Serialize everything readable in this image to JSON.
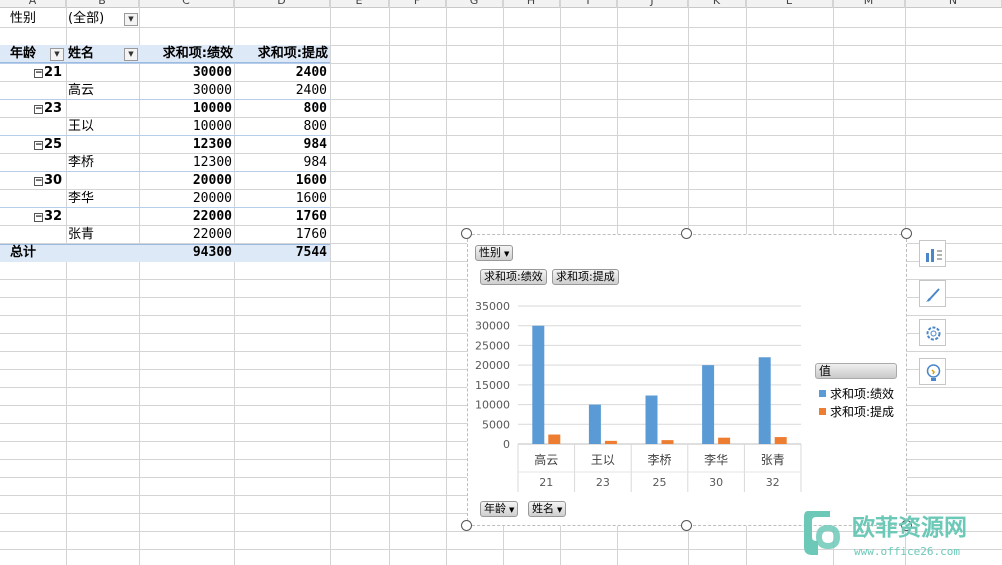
{
  "column_headers": [
    "A",
    "B",
    "C",
    "D",
    "E",
    "F",
    "G",
    "H",
    "I",
    "J",
    "K",
    "L",
    "M",
    "N"
  ],
  "pivot": {
    "filter_label": "性别",
    "filter_value": "(全部)",
    "header": {
      "age": "年龄",
      "name": "姓名",
      "perf": "求和项:绩效",
      "comm": "求和项:提成"
    },
    "groups": [
      {
        "age": "21",
        "perf": "30000",
        "comm": "2400",
        "child": {
          "name": "高云",
          "perf": "30000",
          "comm": "2400"
        }
      },
      {
        "age": "23",
        "perf": "10000",
        "comm": "800",
        "child": {
          "name": "王以",
          "perf": "10000",
          "comm": "800"
        }
      },
      {
        "age": "25",
        "perf": "12300",
        "comm": "984",
        "child": {
          "name": "李桥",
          "perf": "12300",
          "comm": "984"
        }
      },
      {
        "age": "30",
        "perf": "20000",
        "comm": "1600",
        "child": {
          "name": "李华",
          "perf": "20000",
          "comm": "1600"
        }
      },
      {
        "age": "32",
        "perf": "22000",
        "comm": "1760",
        "child": {
          "name": "张青",
          "perf": "22000",
          "comm": "1760"
        }
      }
    ],
    "total": {
      "label": "总计",
      "perf": "94300",
      "comm": "7544"
    }
  },
  "chart_buttons": {
    "filter": "性别",
    "series_perf": "求和项:绩效",
    "series_comm": "求和项:提成",
    "axis_age": "年龄",
    "axis_name": "姓名"
  },
  "chart_data": {
    "type": "bar",
    "categories": [
      "高云",
      "王以",
      "李桥",
      "李华",
      "张青"
    ],
    "outer_categories": [
      "21",
      "23",
      "25",
      "30",
      "32"
    ],
    "series": [
      {
        "name": "求和项:绩效",
        "values": [
          30000,
          10000,
          12300,
          20000,
          22000
        ],
        "color": "#5b9bd5"
      },
      {
        "name": "求和项:提成",
        "values": [
          2400,
          800,
          984,
          1600,
          1760
        ],
        "color": "#ed7d31"
      }
    ],
    "ylim": [
      0,
      35000
    ],
    "yticks": [
      "0",
      "5000",
      "10000",
      "15000",
      "20000",
      "25000",
      "30000",
      "35000"
    ],
    "grid": true,
    "legend_title": "值",
    "legend": "right"
  },
  "watermark": {
    "brand": "欧菲资源网",
    "url": "www.office26.com"
  },
  "colors": {
    "perf": "#5b9bd5",
    "comm": "#ed7d31",
    "pivot_header": "#dde9f7"
  }
}
